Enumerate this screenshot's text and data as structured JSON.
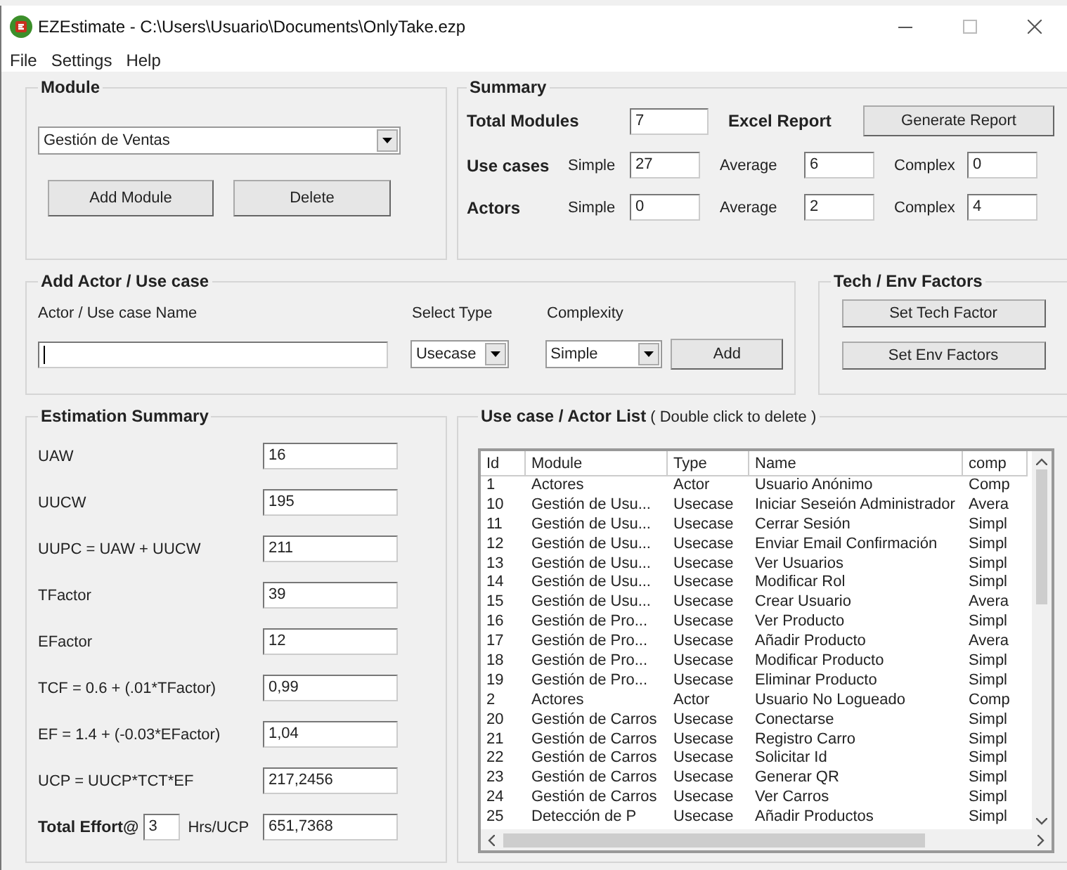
{
  "window": {
    "title": "EZEstimate - C:\\Users\\Usuario\\Documents\\OnlyTake.ezp"
  },
  "menu": [
    "File",
    "Settings",
    "Help"
  ],
  "module": {
    "title": "Module",
    "selected": "Gestión de Ventas",
    "buttons": [
      "Add Module",
      "Delete"
    ]
  },
  "summary": {
    "title": "Summary",
    "total_label": "Total Modules",
    "total": "7",
    "excel_label": "Excel Report",
    "report_button": "Generate Report",
    "rows": [
      {
        "label": "Use cases",
        "fields": [
          {
            "label": "Simple",
            "value": "27"
          },
          {
            "label": "Average",
            "value": "6"
          },
          {
            "label": "Complex",
            "value": "0"
          }
        ]
      },
      {
        "label": "Actors",
        "fields": [
          {
            "label": "Simple",
            "value": "0"
          },
          {
            "label": "Average",
            "value": "2"
          },
          {
            "label": "Complex",
            "value": "4"
          }
        ]
      }
    ]
  },
  "add": {
    "title": "Add Actor / Use case",
    "name_label": "Actor / Use case Name",
    "type_label": "Select Type",
    "type_value": "Usecase",
    "complexity_label": "Complexity",
    "complexity_value": "Simple",
    "add_button": "Add"
  },
  "factors": {
    "title": "Tech / Env Factors",
    "buttons": [
      "Set Tech Factor",
      "Set Env Factors"
    ]
  },
  "estimation": {
    "title": "Estimation Summary",
    "rows": [
      {
        "label": "UAW",
        "value": "16"
      },
      {
        "label": "UUCW",
        "value": "195"
      },
      {
        "label": "UUPC = UAW + UUCW",
        "value": "211"
      },
      {
        "label": "TFactor",
        "value": "39"
      },
      {
        "label": "EFactor",
        "value": "12"
      },
      {
        "label": "TCF = 0.6 + (.01*TFactor)",
        "value": "0,99"
      },
      {
        "label": "EF = 1.4 + (-0.03*EFactor)",
        "value": "1,04"
      },
      {
        "label": "UCP = UUCP*TCT*EF",
        "value": "217,2456"
      }
    ],
    "total": {
      "label": "Total Effort@",
      "hours": "3",
      "unit": "Hrs/UCP",
      "value": "651,7368"
    }
  },
  "list": {
    "title": "Use case / Actor List",
    "hint": "( Double click to delete )",
    "columns": [
      "Id",
      "Module",
      "Type",
      "Name",
      "comp"
    ],
    "rows": [
      [
        "1",
        "Actores",
        "Actor",
        "Usuario Anónimo",
        "Comp"
      ],
      [
        "10",
        "Gestión de Usu...",
        "Usecase",
        "Iniciar Seseión Administrador",
        "Avera"
      ],
      [
        "11",
        "Gestión de Usu...",
        "Usecase",
        "Cerrar Sesión",
        "Simpl"
      ],
      [
        "12",
        "Gestión de Usu...",
        "Usecase",
        "Enviar Email Confirmación",
        "Simpl"
      ],
      [
        "13",
        "Gestión de Usu...",
        "Usecase",
        "Ver Usuarios",
        "Simpl"
      ],
      [
        "14",
        "Gestión de Usu...",
        "Usecase",
        "Modificar Rol",
        "Simpl"
      ],
      [
        "15",
        "Gestión de Usu...",
        "Usecase",
        "Crear Usuario",
        "Avera"
      ],
      [
        "16",
        "Gestión de Pro...",
        "Usecase",
        "Ver Producto",
        "Simpl"
      ],
      [
        "17",
        "Gestión de Pro...",
        "Usecase",
        "Añadir Producto",
        "Avera"
      ],
      [
        "18",
        "Gestión de Pro...",
        "Usecase",
        "Modificar Producto",
        "Simpl"
      ],
      [
        "19",
        "Gestión de Pro...",
        "Usecase",
        "Eliminar Producto",
        "Simpl"
      ],
      [
        "2",
        "Actores",
        "Actor",
        "Usuario No Logueado",
        "Comp"
      ],
      [
        "20",
        "Gestión de Carros",
        "Usecase",
        "Conectarse",
        "Simpl"
      ],
      [
        "21",
        "Gestión de Carros",
        "Usecase",
        "Registro Carro",
        "Simpl"
      ],
      [
        "22",
        "Gestión de Carros",
        "Usecase",
        "Solicitar Id",
        "Simpl"
      ],
      [
        "23",
        "Gestión de Carros",
        "Usecase",
        "Generar QR",
        "Simpl"
      ],
      [
        "24",
        "Gestión de Carros",
        "Usecase",
        "Ver Carros",
        "Simpl"
      ],
      [
        "25",
        "Detección de P",
        "Usecase",
        "Añadir Productos",
        "Simpl"
      ]
    ]
  }
}
